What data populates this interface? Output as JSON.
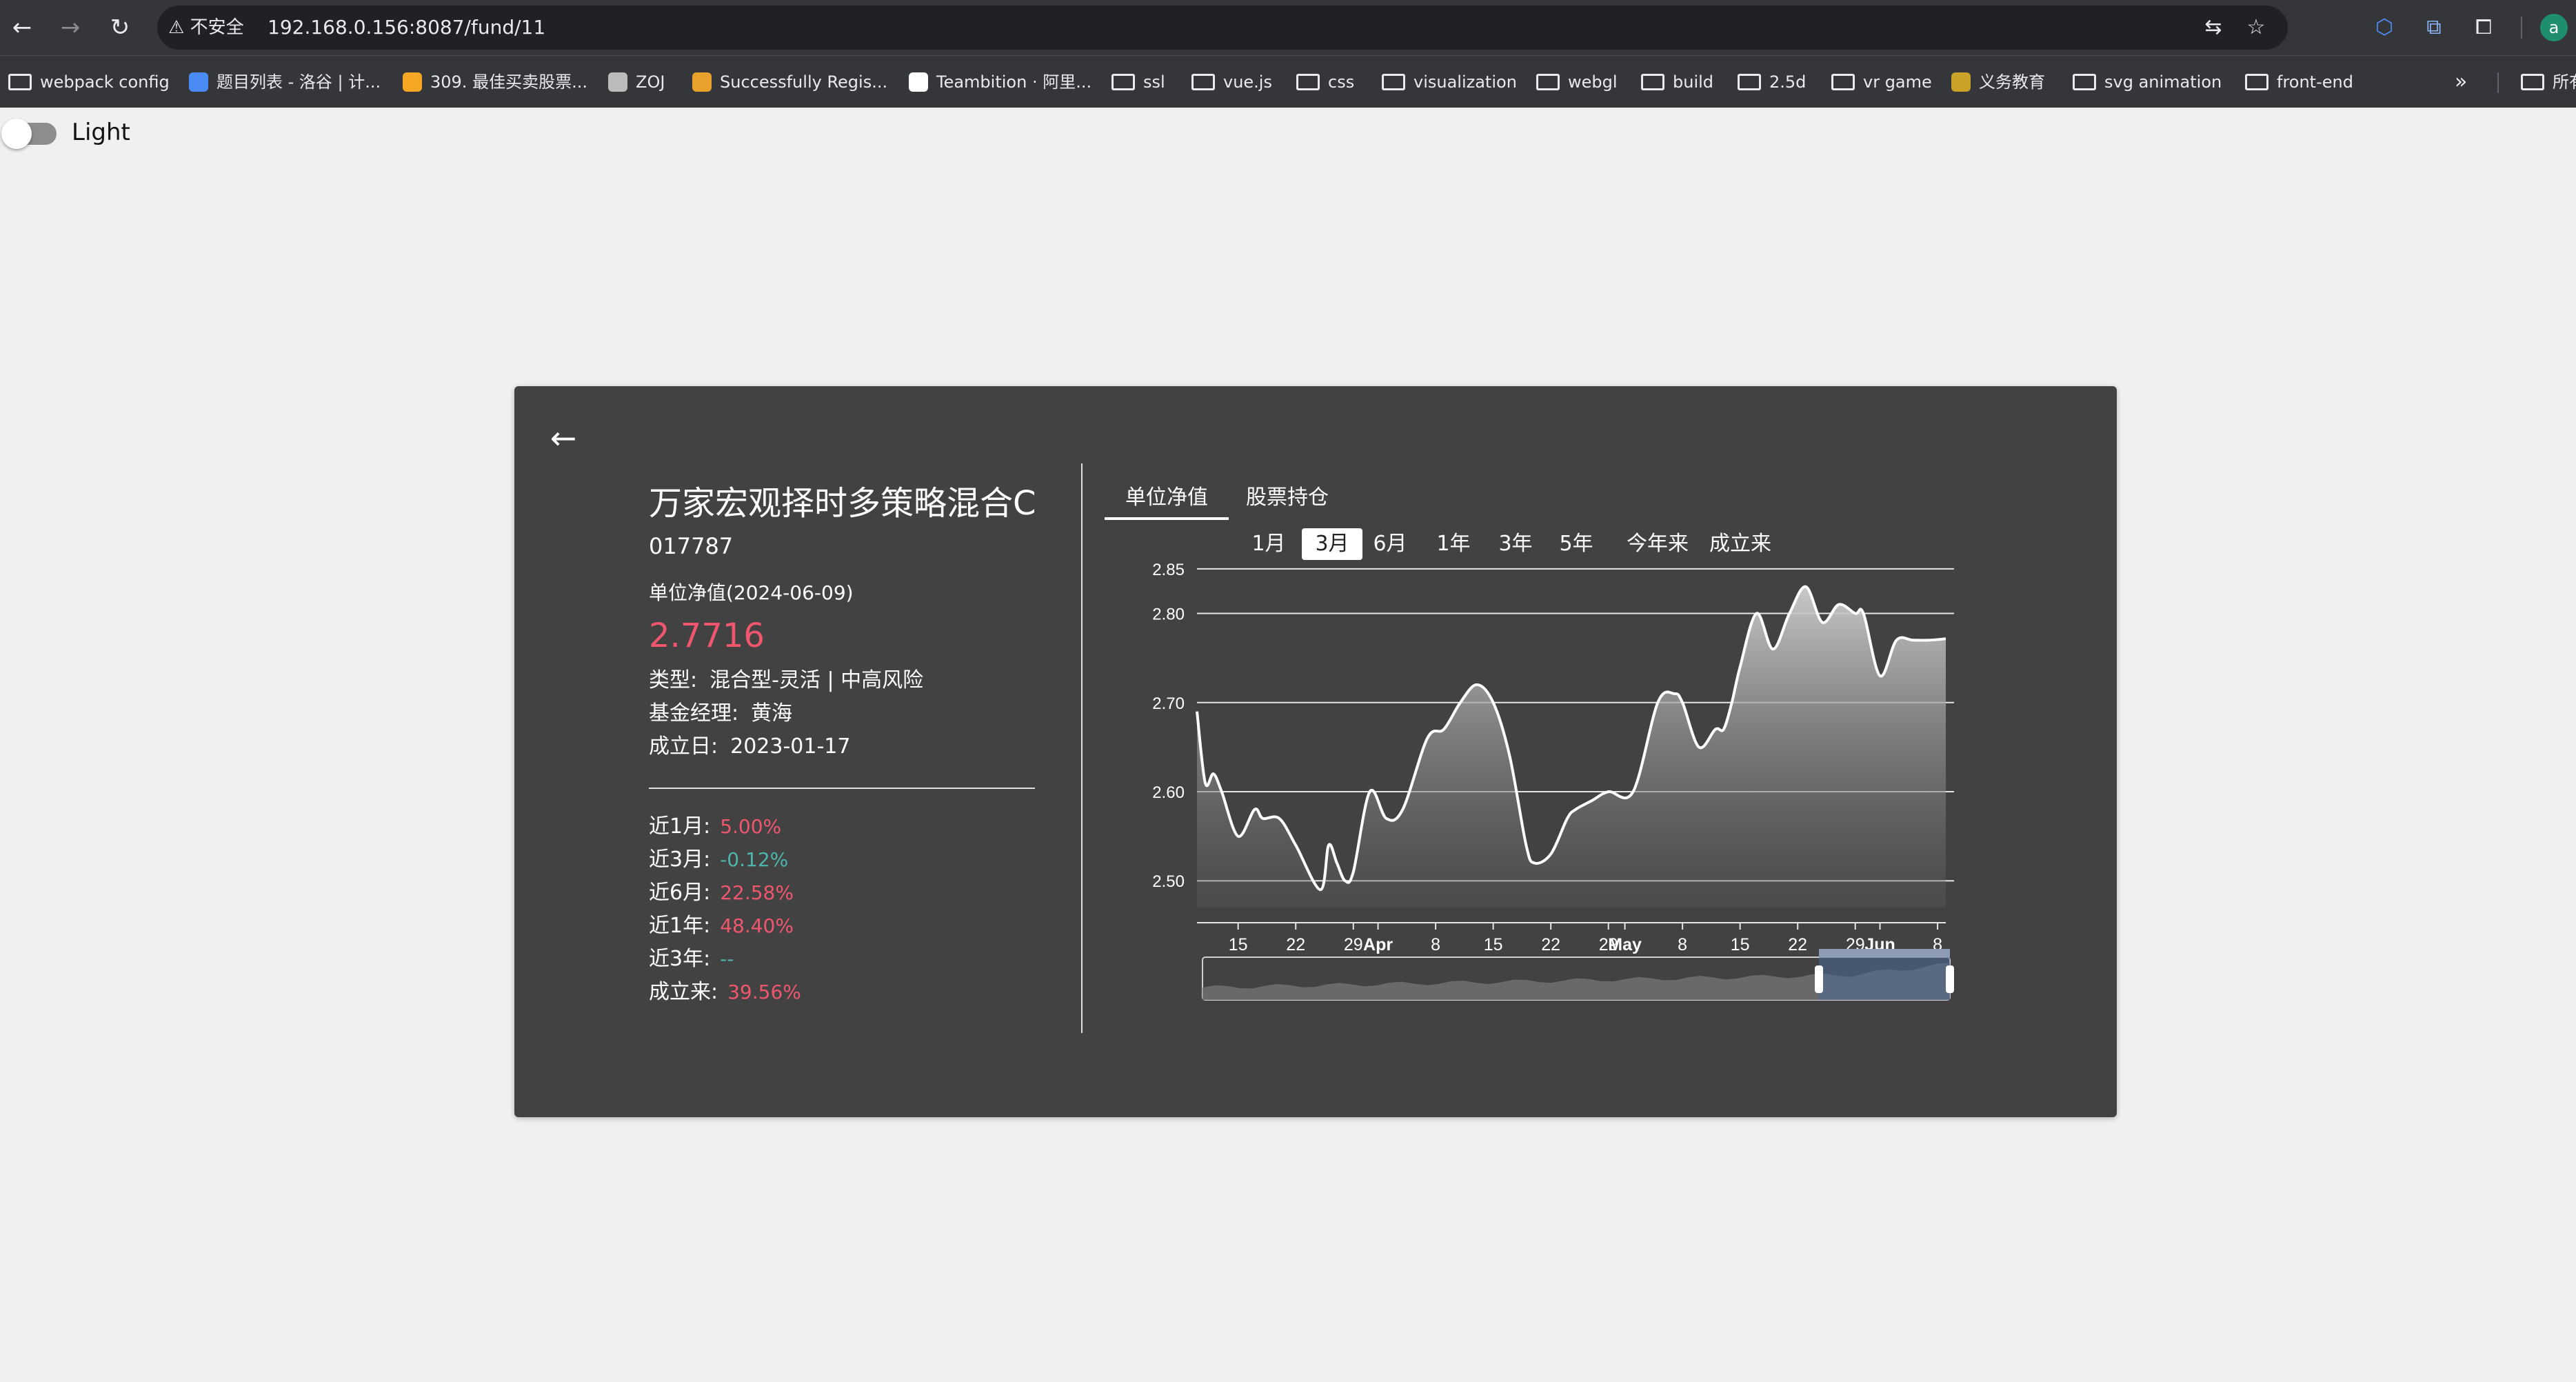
{
  "browser": {
    "security_label": "不安全",
    "url": "192.168.0.156:8087/fund/11",
    "profile_initial": "a",
    "bookmarks": [
      {
        "label": "webpack config",
        "type": "folder"
      },
      {
        "label": "题目列表 - 洛谷 | 计...",
        "type": "page"
      },
      {
        "label": "309. 最佳买卖股票...",
        "type": "page"
      },
      {
        "label": "ZOJ",
        "type": "page"
      },
      {
        "label": "Successfully Regis...",
        "type": "page"
      },
      {
        "label": "Teambition · 阿里...",
        "type": "page"
      },
      {
        "label": "ssl",
        "type": "folder"
      },
      {
        "label": "vue.js",
        "type": "folder"
      },
      {
        "label": "css",
        "type": "folder"
      },
      {
        "label": "visualization",
        "type": "folder"
      },
      {
        "label": "webgl",
        "type": "folder"
      },
      {
        "label": "build",
        "type": "folder"
      },
      {
        "label": "2.5d",
        "type": "folder"
      },
      {
        "label": "vr game",
        "type": "folder"
      },
      {
        "label": "义务教育",
        "type": "page"
      },
      {
        "label": "svg animation",
        "type": "folder"
      },
      {
        "label": "front-end",
        "type": "folder"
      }
    ],
    "overflow": "»",
    "all_bookmarks": "所有"
  },
  "theme_toggle": {
    "label": "Light",
    "on": false
  },
  "fund": {
    "name": "万家宏观择时多策略混合C",
    "code": "017787",
    "nav_label": "单位净值(2024-06-09)",
    "nav_value": "2.7716",
    "type_label": "类型:",
    "type_value": "混合型-灵活 | 中高风险",
    "manager_label": "基金经理:",
    "manager_value": "黄海",
    "inception_label": "成立日:",
    "inception_value": "2023-01-17",
    "performance": [
      {
        "label": "近1月:",
        "value": "5.00%",
        "sign": "pos"
      },
      {
        "label": "近3月:",
        "value": "-0.12%",
        "sign": "neg"
      },
      {
        "label": "近6月:",
        "value": "22.58%",
        "sign": "pos"
      },
      {
        "label": "近1年:",
        "value": "48.40%",
        "sign": "pos"
      },
      {
        "label": "近3年:",
        "value": "--",
        "sign": "neg"
      },
      {
        "label": "成立来:",
        "value": "39.56%",
        "sign": "pos"
      }
    ]
  },
  "tabs": [
    {
      "label": "单位净值",
      "active": true
    },
    {
      "label": "股票持仓",
      "active": false
    }
  ],
  "ranges": [
    {
      "label": "1月",
      "active": false
    },
    {
      "label": "3月",
      "active": true
    },
    {
      "label": "6月",
      "active": false
    },
    {
      "label": "1年",
      "active": false
    },
    {
      "label": "3年",
      "active": false
    },
    {
      "label": "5年",
      "active": false
    },
    {
      "label": "今年来",
      "active": false
    },
    {
      "label": "成立来",
      "active": false
    }
  ],
  "colors": {
    "positive": "#f0566e",
    "negative": "#4db6ac",
    "card": "#424242"
  },
  "chart_data": {
    "type": "area",
    "ylim": [
      2.47,
      2.86
    ],
    "y_ticks": [
      2.5,
      2.6,
      2.7,
      2.8,
      2.85
    ],
    "x_ticks": [
      "15",
      "22",
      "29",
      "Apr",
      "8",
      "15",
      "22",
      "29",
      "May",
      "8",
      "15",
      "22",
      "29",
      "Jun",
      "8"
    ],
    "x_tick_dates": [
      "2024-03-15",
      "2024-03-22",
      "2024-03-29",
      "2024-04-01",
      "2024-04-08",
      "2024-04-15",
      "2024-04-22",
      "2024-04-29",
      "2024-05-01",
      "2024-05-08",
      "2024-05-15",
      "2024-05-22",
      "2024-05-29",
      "2024-06-01",
      "2024-06-08"
    ],
    "x_range": [
      "2024-03-10",
      "2024-06-09"
    ],
    "grid": true,
    "x": [
      "2024-03-10",
      "2024-03-11",
      "2024-03-12",
      "2024-03-13",
      "2024-03-15",
      "2024-03-17",
      "2024-03-18",
      "2024-03-20",
      "2024-03-22",
      "2024-03-25",
      "2024-03-26",
      "2024-03-27",
      "2024-03-28",
      "2024-03-29",
      "2024-03-31",
      "2024-04-02",
      "2024-04-04",
      "2024-04-07",
      "2024-04-09",
      "2024-04-11",
      "2024-04-13",
      "2024-04-15",
      "2024-04-17",
      "2024-04-19",
      "2024-04-20",
      "2024-04-22",
      "2024-04-24",
      "2024-04-25",
      "2024-04-27",
      "2024-04-29",
      "2024-05-02",
      "2024-05-05",
      "2024-05-07",
      "2024-05-08",
      "2024-05-10",
      "2024-05-12",
      "2024-05-13",
      "2024-05-14",
      "2024-05-15",
      "2024-05-17",
      "2024-05-19",
      "2024-05-21",
      "2024-05-23",
      "2024-05-25",
      "2024-05-27",
      "2024-05-29",
      "2024-05-30",
      "2024-06-01",
      "2024-06-03",
      "2024-06-05",
      "2024-06-07",
      "2024-06-09"
    ],
    "values": [
      2.69,
      2.61,
      2.62,
      2.6,
      2.55,
      2.58,
      2.57,
      2.57,
      2.54,
      2.49,
      2.54,
      2.52,
      2.5,
      2.51,
      2.6,
      2.57,
      2.58,
      2.66,
      2.67,
      2.7,
      2.72,
      2.7,
      2.64,
      2.54,
      2.52,
      2.53,
      2.57,
      2.58,
      2.59,
      2.6,
      2.6,
      2.7,
      2.71,
      2.7,
      2.65,
      2.67,
      2.67,
      2.7,
      2.74,
      2.8,
      2.76,
      2.8,
      2.83,
      2.79,
      2.81,
      2.8,
      2.8,
      2.73,
      2.77,
      2.77,
      2.77,
      2.7716
    ],
    "minimap_window": [
      "2024-03-10",
      "2024-06-09"
    ]
  }
}
